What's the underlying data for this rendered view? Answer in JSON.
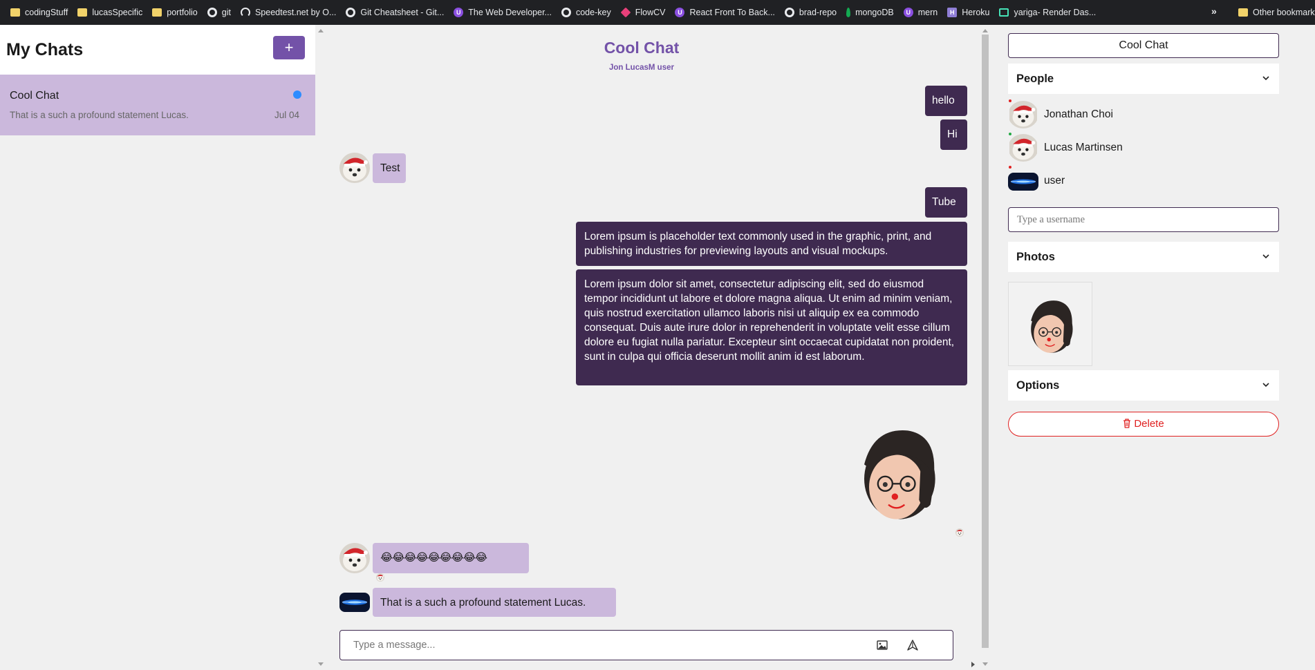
{
  "bookmarks": {
    "items": [
      {
        "label": "codingStuff",
        "icon": "folder-icon"
      },
      {
        "label": "lucasSpecific",
        "icon": "folder-icon"
      },
      {
        "label": "portfolio",
        "icon": "folder-icon"
      },
      {
        "label": "git",
        "icon": "github-icon"
      },
      {
        "label": "Speedtest.net by O...",
        "icon": "speedtest-icon"
      },
      {
        "label": "Git Cheatsheet - Git...",
        "icon": "github-icon"
      },
      {
        "label": "The Web Developer...",
        "icon": "udemy-icon"
      },
      {
        "label": "code-key",
        "icon": "github-icon"
      },
      {
        "label": "FlowCV",
        "icon": "flowcv-icon"
      },
      {
        "label": "React Front To Back...",
        "icon": "udemy-icon"
      },
      {
        "label": "brad-repo",
        "icon": "github-icon"
      },
      {
        "label": "mongoDB",
        "icon": "mongodb-icon"
      },
      {
        "label": "mern",
        "icon": "udemy-icon"
      },
      {
        "label": "Heroku",
        "icon": "heroku-icon"
      },
      {
        "label": "yariga- Render Das...",
        "icon": "render-icon"
      }
    ],
    "more": "»",
    "other": "Other bookmarks"
  },
  "sidebar": {
    "title": "My Chats",
    "add_label": "+",
    "chats": [
      {
        "name": "Cool Chat",
        "preview": "That is a such a profound statement Lucas.",
        "date": "Jul 04"
      }
    ]
  },
  "chat": {
    "title": "Cool Chat",
    "subtitle": "Jon LucasM user",
    "messages": [
      {
        "side": "right",
        "text": "hello"
      },
      {
        "side": "right",
        "text": "Hi"
      },
      {
        "side": "left",
        "sender": "Jonathan Choi",
        "text": "Test"
      },
      {
        "side": "right",
        "text": "Tube"
      },
      {
        "side": "right",
        "text": "Lorem ipsum is placeholder text commonly used in the graphic, print, and publishing industries for previewing layouts and visual mockups."
      },
      {
        "side": "right",
        "text": "Lorem ipsum dolor sit amet, consectetur adipiscing elit, sed do eiusmod tempor incididunt ut labore et dolore magna aliqua. Ut enim ad minim veniam, quis nostrud exercitation ullamco laboris nisi ut aliquip ex ea commodo consequat. Duis aute irure dolor in reprehenderit in voluptate velit esse cillum dolore eu fugiat nulla pariatur. Excepteur sint occaecat cupidatat non proident, sunt in culpa qui officia deserunt mollit anim id est laborum."
      },
      {
        "side": "right",
        "type": "image",
        "image": "avatar-cartoon-image"
      },
      {
        "side": "left",
        "sender": "Jonathan Choi",
        "text": "😂😂😂😂😂😂😂😂😂"
      },
      {
        "side": "left",
        "sender": "user",
        "text": "That is a such a profound statement Lucas."
      }
    ],
    "composer": {
      "placeholder": "Type a message..."
    }
  },
  "details": {
    "chat_name": "Cool Chat",
    "people_label": "People",
    "people": [
      {
        "name": "Jonathan Choi",
        "status_color": "#e02020"
      },
      {
        "name": "Lucas Martinsen",
        "status_color": "#22aa44"
      },
      {
        "name": "user",
        "status_color": "#e02020"
      }
    ],
    "username_placeholder": "Type a username",
    "photos_label": "Photos",
    "options_label": "Options",
    "delete_label": "Delete"
  },
  "colors": {
    "accent": "#7352a8",
    "own_bubble": "#3f2a50",
    "other_bubble": "#cbb8dc",
    "unread": "#2d8cff",
    "danger": "#e02020"
  }
}
